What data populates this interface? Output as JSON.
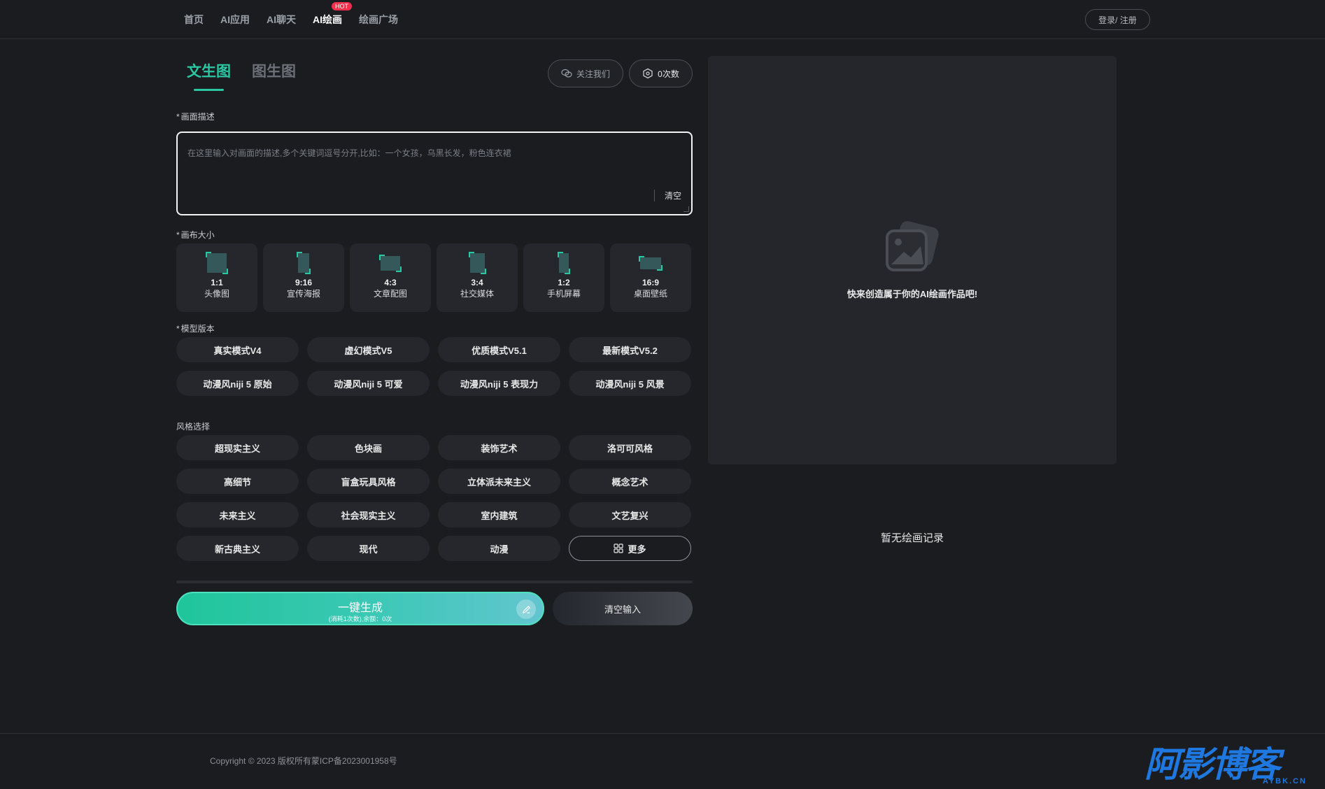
{
  "nav": {
    "items": [
      {
        "label": "首页",
        "active": false
      },
      {
        "label": "AI应用",
        "active": false
      },
      {
        "label": "AI聊天",
        "active": false
      },
      {
        "label": "AI绘画",
        "active": true,
        "badge": "HOT"
      },
      {
        "label": "绘画广场",
        "active": false
      }
    ],
    "login_label": "登录/ 注册"
  },
  "tabs": [
    "文生图",
    "图生图"
  ],
  "header_buttons": {
    "follow_label": "关注我们",
    "count_label": "0次数"
  },
  "prompt": {
    "label": "画面描述",
    "placeholder": "在这里输入对画面的描述,多个关键词逗号分开,比如：一个女孩，乌黑长发，粉色连衣裙",
    "value": "",
    "clear_label": "清空"
  },
  "canvas": {
    "label": "画布大小",
    "sizes": [
      {
        "ratio": "1:1",
        "name": "头像图"
      },
      {
        "ratio": "9:16",
        "name": "宣传海报"
      },
      {
        "ratio": "4:3",
        "name": "文章配图"
      },
      {
        "ratio": "3:4",
        "name": "社交媒体"
      },
      {
        "ratio": "1:2",
        "name": "手机屏幕"
      },
      {
        "ratio": "16:9",
        "name": "桌面壁纸"
      }
    ]
  },
  "model": {
    "label": "模型版本",
    "options": [
      "真实模式V4",
      "虚幻模式V5",
      "优质模式V5.1",
      "最新模式V5.2",
      "动漫风niji 5 原始",
      "动漫风niji 5 可爱",
      "动漫风niji 5 表现力",
      "动漫风niji 5 风景"
    ]
  },
  "style": {
    "label": "风格选择",
    "options": [
      "超现实主义",
      "色块画",
      "装饰艺术",
      "洛可可风格",
      "高细节",
      "盲盒玩具风格",
      "立体派未来主义",
      "概念艺术",
      "未来主义",
      "社会现实主义",
      "室内建筑",
      "文艺复兴",
      "新古典主义",
      "现代",
      "动漫"
    ],
    "more_label": "更多"
  },
  "actions": {
    "generate_label": "一键生成",
    "generate_sub": "(消耗1次数),余额：0次",
    "clear_input_label": "清空输入"
  },
  "preview": {
    "hint": "快来创造属于你的AI绘画作品吧!",
    "no_record": "暂无绘画记录"
  },
  "footer": {
    "copyright": "Copyright © 2023 版权所有蒙ICP备2023001958号",
    "watermark_big": "阿影博客",
    "watermark_small": "AYBK.CN"
  },
  "colors": {
    "accent": "#2ac7a3",
    "background": "#1b1c1f",
    "card": "#25272c",
    "hot_badge": "#f0304c",
    "watermark": "#1f77e0"
  }
}
